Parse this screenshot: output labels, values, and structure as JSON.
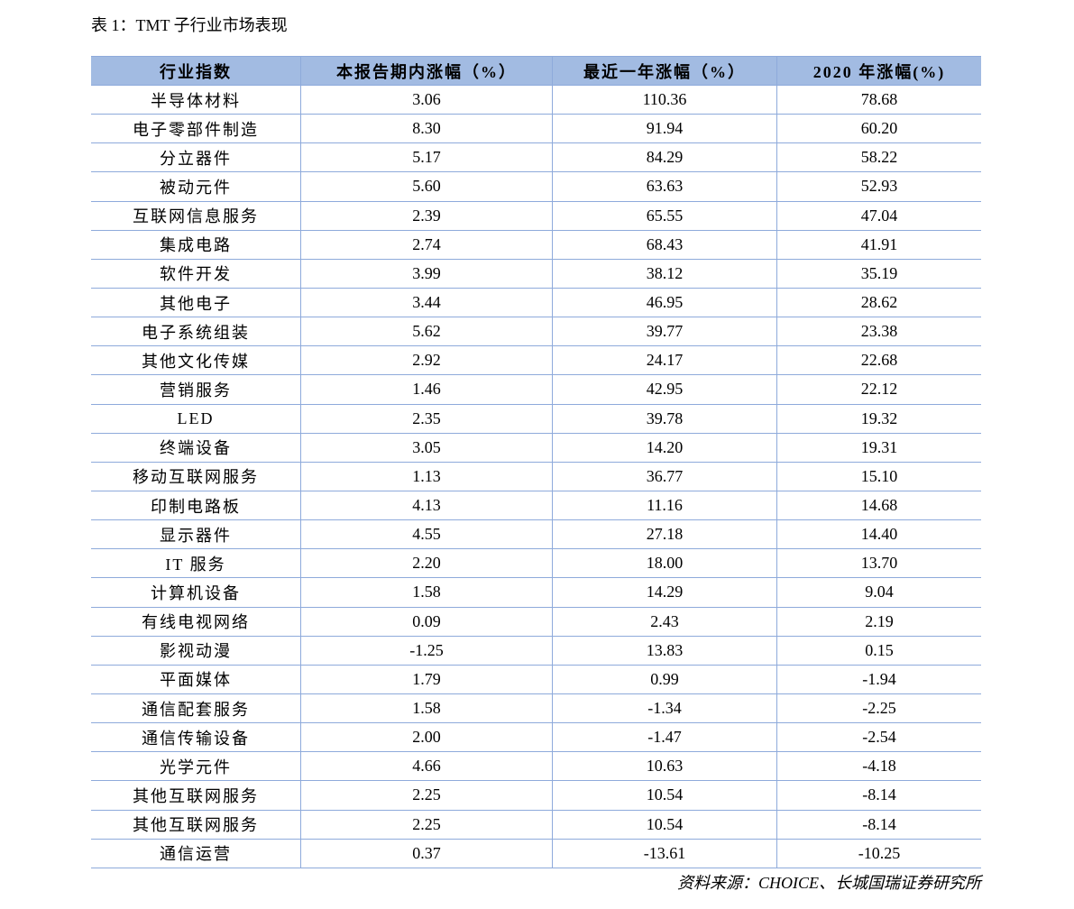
{
  "caption": "表 1：TMT 子行业市场表现",
  "table": {
    "headers": [
      "行业指数",
      "本报告期内涨幅（%）",
      "最近一年涨幅（%）",
      "2020 年涨幅(%)"
    ],
    "rows": [
      [
        "半导体材料",
        "3.06",
        "110.36",
        "78.68"
      ],
      [
        "电子零部件制造",
        "8.30",
        "91.94",
        "60.20"
      ],
      [
        "分立器件",
        "5.17",
        "84.29",
        "58.22"
      ],
      [
        "被动元件",
        "5.60",
        "63.63",
        "52.93"
      ],
      [
        "互联网信息服务",
        "2.39",
        "65.55",
        "47.04"
      ],
      [
        "集成电路",
        "2.74",
        "68.43",
        "41.91"
      ],
      [
        "软件开发",
        "3.99",
        "38.12",
        "35.19"
      ],
      [
        "其他电子",
        "3.44",
        "46.95",
        "28.62"
      ],
      [
        "电子系统组装",
        "5.62",
        "39.77",
        "23.38"
      ],
      [
        "其他文化传媒",
        "2.92",
        "24.17",
        "22.68"
      ],
      [
        "营销服务",
        "1.46",
        "42.95",
        "22.12"
      ],
      [
        "LED",
        "2.35",
        "39.78",
        "19.32"
      ],
      [
        "终端设备",
        "3.05",
        "14.20",
        "19.31"
      ],
      [
        "移动互联网服务",
        "1.13",
        "36.77",
        "15.10"
      ],
      [
        "印制电路板",
        "4.13",
        "11.16",
        "14.68"
      ],
      [
        "显示器件",
        "4.55",
        "27.18",
        "14.40"
      ],
      [
        "IT 服务",
        "2.20",
        "18.00",
        "13.70"
      ],
      [
        "计算机设备",
        "1.58",
        "14.29",
        "9.04"
      ],
      [
        "有线电视网络",
        "0.09",
        "2.43",
        "2.19"
      ],
      [
        "影视动漫",
        "-1.25",
        "13.83",
        "0.15"
      ],
      [
        "平面媒体",
        "1.79",
        "0.99",
        "-1.94"
      ],
      [
        "通信配套服务",
        "1.58",
        "-1.34",
        "-2.25"
      ],
      [
        "通信传输设备",
        "2.00",
        "-1.47",
        "-2.54"
      ],
      [
        "光学元件",
        "4.66",
        "10.63",
        "-4.18"
      ],
      [
        "其他互联网服务",
        "2.25",
        "10.54",
        "-8.14"
      ],
      [
        "其他互联网服务",
        "2.25",
        "10.54",
        "-8.14"
      ],
      [
        "通信运营",
        "0.37",
        "-13.61",
        "-10.25"
      ]
    ]
  },
  "source": "资料来源：CHOICE、长城国瑞证券研究所",
  "colors": {
    "header_bg": "#A2BBE2",
    "rule": "#8EAADB"
  }
}
